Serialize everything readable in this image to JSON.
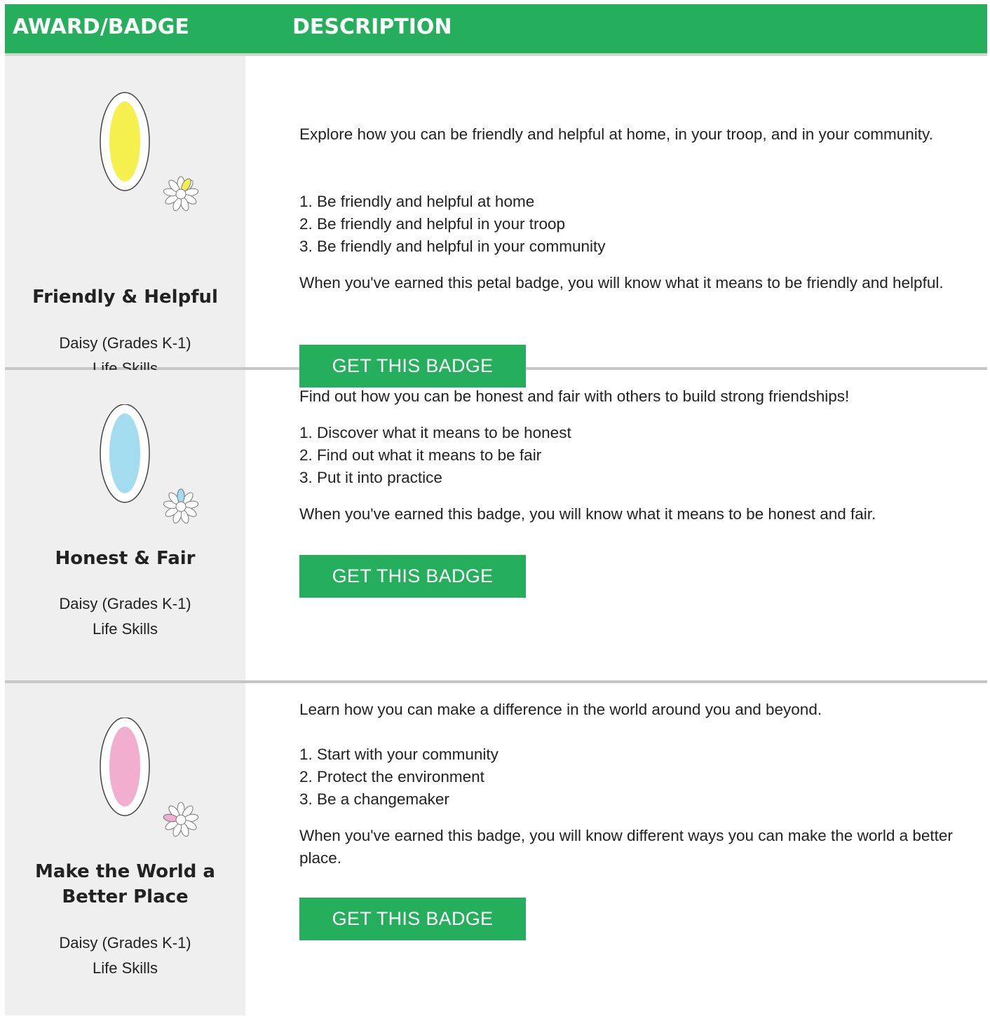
{
  "header": {
    "award_label": "AWARD/BADGE",
    "description_label": "DESCRIPTION"
  },
  "colors": {
    "header_green": "#25ae5c",
    "button_green": "#25ae5c",
    "left_column_bg": "#efefef",
    "row_divider": "#c6c6c6"
  },
  "badges": [
    {
      "name": "Friendly & Helpful",
      "level": "Daisy (Grades K-1)",
      "category": "Life Skills",
      "petal_color": "#f6f04e",
      "petal_icon": "yellow-petal-icon",
      "intro": "Explore how you can be friendly and helpful at home, in your troop, and in your community.",
      "steps": [
        "1. Be friendly and helpful at home",
        "2. Be friendly and helpful in your troop",
        "3. Be friendly and helpful in your community"
      ],
      "outcome": "When you've earned this petal badge, you will know what it means to be friendly and helpful.",
      "button_label": "GET THIS BADGE"
    },
    {
      "name": "Honest & Fair",
      "level": "Daisy (Grades K-1)",
      "category": "Life Skills",
      "petal_color": "#a3dcef",
      "petal_icon": "blue-petal-icon",
      "intro": "Find out how you can be honest and fair with others to build strong friendships!",
      "steps": [
        "1. Discover what it means to be honest",
        "2. Find out what it means to be fair",
        "3. Put it into practice"
      ],
      "outcome": "When you've earned this badge, you will know what it means to be honest and fair.",
      "button_label": "GET THIS BADGE"
    },
    {
      "name": "Make the World a Better Place",
      "level": "Daisy (Grades K-1)",
      "category": "Life Skills",
      "petal_color": "#f2aecf",
      "petal_icon": "pink-petal-icon",
      "intro": "Learn how you can make a difference in the world around you and beyond.",
      "steps": [
        "1. Start with your community",
        "2. Protect the environment",
        "3. Be a changemaker"
      ],
      "outcome": "When you've earned this badge, you will know different ways you can make the world a better place.",
      "button_label": "GET THIS BADGE"
    }
  ]
}
